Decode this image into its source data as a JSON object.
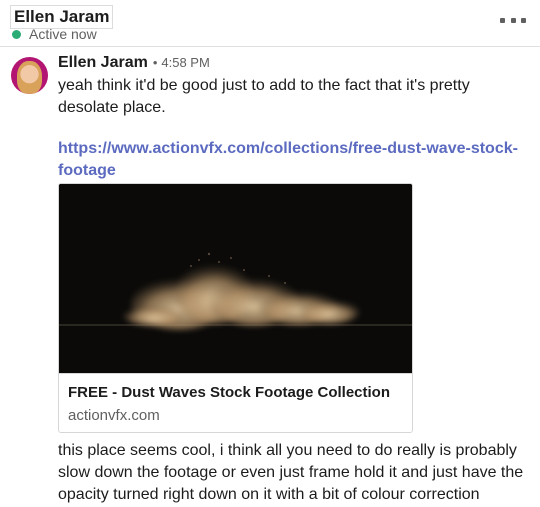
{
  "header": {
    "name": "Ellen Jaram",
    "status": "Active now"
  },
  "message": {
    "author": "Ellen Jaram",
    "separator": "•",
    "time": "4:58 PM",
    "text_1": "yeah think it'd be good just to add to the fact that it's pretty desolate place.",
    "link": "https://www.actionvfx.com/collections/free-dust-wave-stock-footage",
    "preview": {
      "title": "FREE - Dust Waves Stock Footage Collection",
      "domain": "actionvfx.com"
    },
    "text_2": "this place seems cool, i think all you need to do really is probably slow down the footage or even just frame hold it and just have the opacity turned right down on it with a bit of colour correction"
  },
  "colors": {
    "status_active": "#2bac76",
    "link": "#5c6bc0",
    "avatar_bg": "#b31572"
  },
  "icons": {
    "more": "more-horizontal-icon"
  }
}
